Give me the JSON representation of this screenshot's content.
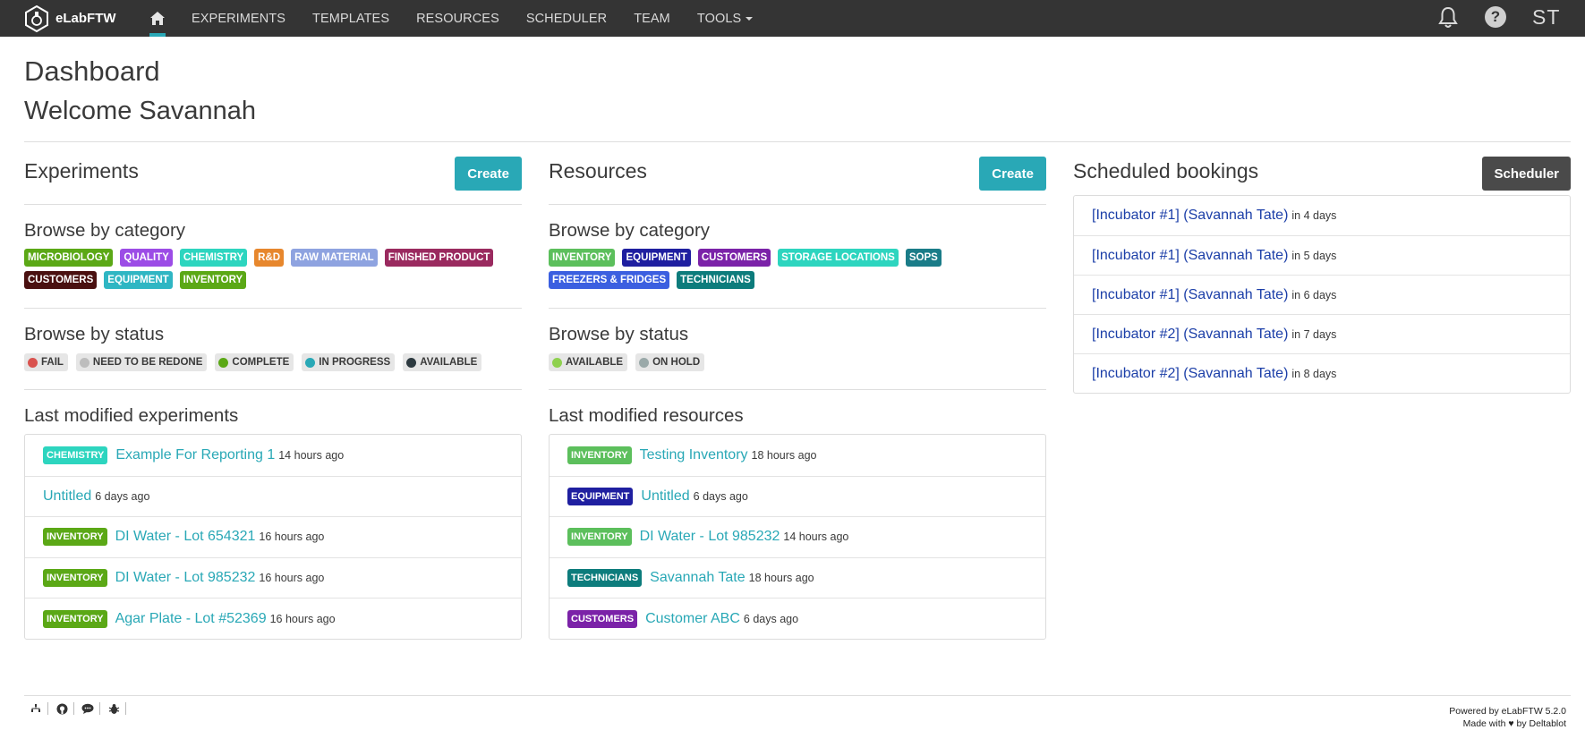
{
  "app": {
    "name": "eLabFTW"
  },
  "nav": {
    "links": [
      "EXPERIMENTS",
      "TEMPLATES",
      "RESOURCES",
      "SCHEDULER",
      "TEAM",
      "TOOLS"
    ],
    "initials": "ST",
    "help_glyph": "?"
  },
  "page": {
    "title": "Dashboard",
    "welcome": "Welcome Savannah"
  },
  "experiments": {
    "title": "Experiments",
    "create_label": "Create",
    "browse_category_title": "Browse by category",
    "categories": [
      {
        "label": "MICROBIOLOGY",
        "color": "#5ba816"
      },
      {
        "label": "QUALITY",
        "color": "#9c4ce6"
      },
      {
        "label": "CHEMISTRY",
        "color": "#2dd5bf"
      },
      {
        "label": "R&D",
        "color": "#e7872d"
      },
      {
        "label": "RAW MATERIAL",
        "color": "#8ea3e0"
      },
      {
        "label": "FINISHED PRODUCT",
        "color": "#9a2a5f"
      },
      {
        "label": "CUSTOMERS",
        "color": "#4a1010"
      },
      {
        "label": "EQUIPMENT",
        "color": "#2fb6c3"
      },
      {
        "label": "INVENTORY",
        "color": "#5ba816"
      }
    ],
    "browse_status_title": "Browse by status",
    "statuses": [
      {
        "label": "FAIL",
        "color": "#d9534f"
      },
      {
        "label": "NEED TO BE REDONE",
        "color": "#bdbdbd"
      },
      {
        "label": "COMPLETE",
        "color": "#5ba816"
      },
      {
        "label": "IN PROGRESS",
        "color": "#29a8b6"
      },
      {
        "label": "AVAILABLE",
        "color": "#2d3a40"
      }
    ],
    "last_modified_title": "Last modified experiments",
    "items": [
      {
        "tag": "CHEMISTRY",
        "tag_color": "#2dd5bf",
        "title": "Example For Reporting 1",
        "time": "14 hours ago"
      },
      {
        "tag": "",
        "tag_color": "",
        "title": "Untitled",
        "time": "6 days ago"
      },
      {
        "tag": "INVENTORY",
        "tag_color": "#5ba816",
        "title": "DI Water - Lot 654321",
        "time": "16 hours ago"
      },
      {
        "tag": "INVENTORY",
        "tag_color": "#5ba816",
        "title": "DI Water - Lot 985232",
        "time": "16 hours ago"
      },
      {
        "tag": "INVENTORY",
        "tag_color": "#5ba816",
        "title": "Agar Plate - Lot #52369",
        "time": "16 hours ago"
      }
    ]
  },
  "resources": {
    "title": "Resources",
    "create_label": "Create",
    "browse_category_title": "Browse by category",
    "categories": [
      {
        "label": "INVENTORY",
        "color": "#5cbf5c"
      },
      {
        "label": "EQUIPMENT",
        "color": "#1f1fa0"
      },
      {
        "label": "CUSTOMERS",
        "color": "#7b22a8"
      },
      {
        "label": "STORAGE LOCATIONS",
        "color": "#2dd5bf"
      },
      {
        "label": "SOPS",
        "color": "#1a7c88"
      },
      {
        "label": "FREEZERS & FRIDGES",
        "color": "#3b5fe0"
      },
      {
        "label": "TECHNICIANS",
        "color": "#0d7c7c"
      }
    ],
    "browse_status_title": "Browse by status",
    "statuses": [
      {
        "label": "AVAILABLE",
        "color": "#8fd14f"
      },
      {
        "label": "ON HOLD",
        "color": "#9aa9a9"
      }
    ],
    "last_modified_title": "Last modified resources",
    "items": [
      {
        "tag": "INVENTORY",
        "tag_color": "#5cbf5c",
        "title": "Testing Inventory",
        "time": "18 hours ago"
      },
      {
        "tag": "EQUIPMENT",
        "tag_color": "#1f1fa0",
        "title": "Untitled",
        "time": "6 days ago"
      },
      {
        "tag": "INVENTORY",
        "tag_color": "#5cbf5c",
        "title": "DI Water - Lot 985232",
        "time": "14 hours ago"
      },
      {
        "tag": "TECHNICIANS",
        "tag_color": "#0d7c7c",
        "title": "Savannah Tate",
        "time": "18 hours ago"
      },
      {
        "tag": "CUSTOMERS",
        "tag_color": "#7b22a8",
        "title": "Customer ABC",
        "time": "6 days ago"
      }
    ]
  },
  "bookings": {
    "title": "Scheduled bookings",
    "scheduler_label": "Scheduler",
    "items": [
      {
        "title": "[Incubator #1] (Savannah Tate)",
        "time": "in 4 days"
      },
      {
        "title": "[Incubator #1] (Savannah Tate)",
        "time": "in 5 days"
      },
      {
        "title": "[Incubator #1] (Savannah Tate)",
        "time": "in 6 days"
      },
      {
        "title": "[Incubator #2] (Savannah Tate)",
        "time": "in 7 days"
      },
      {
        "title": "[Incubator #2] (Savannah Tate)",
        "time": "in 8 days"
      }
    ]
  },
  "footer": {
    "powered": "Powered by eLabFTW 5.2.0",
    "made": "Made with ♥ by Deltablot",
    "icons": [
      "sitemap-icon",
      "github-icon",
      "chat-icon",
      "bug-icon"
    ]
  }
}
